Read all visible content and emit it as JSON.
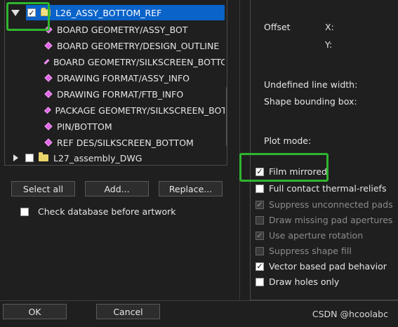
{
  "tree": {
    "items": [
      {
        "label": "L26_ASSY_BOTTOM_REF",
        "checked": "✓"
      },
      {
        "label": "BOARD GEOMETRY/ASSY_BOT"
      },
      {
        "label": "BOARD GEOMETRY/DESIGN_OUTLINE"
      },
      {
        "label": "BOARD GEOMETRY/SILKSCREEN_BOTTC"
      },
      {
        "label": "DRAWING FORMAT/ASSY_INFO"
      },
      {
        "label": "DRAWING FORMAT/FTB_INFO"
      },
      {
        "label": "PACKAGE GEOMETRY/SILKSCREEN_BOT"
      },
      {
        "label": "PIN/BOTTOM"
      },
      {
        "label": "REF DES/SILKSCREEN_BOTTOM"
      },
      {
        "label": "L27_assembly_DWG"
      }
    ]
  },
  "buttons": {
    "select_all": "Select all",
    "add": "Add...",
    "replace": "Replace...",
    "ok": "OK",
    "cancel": "Cancel"
  },
  "check_database": {
    "label": "Check database before artwork",
    "checked": ""
  },
  "right": {
    "offset_label": "Offset",
    "x_label": "X:",
    "y_label": "Y:",
    "undefined_line_width": "Undefined line width:",
    "shape_bounding_box": "Shape bounding box:",
    "plot_mode": "Plot mode:",
    "options": [
      {
        "label": "Film mirrored",
        "checked": "✓"
      },
      {
        "label": "Full contact thermal-reliefs",
        "checked": ""
      },
      {
        "label": "Suppress unconnected pads",
        "checked": "✓"
      },
      {
        "label": "Draw missing pad apertures",
        "checked": ""
      },
      {
        "label": "Use aperture rotation",
        "checked": "✓"
      },
      {
        "label": "Suppress shape fill",
        "checked": ""
      },
      {
        "label": "Vector based pad behavior",
        "checked": "✓"
      },
      {
        "label": "Draw holes only",
        "checked": ""
      }
    ]
  },
  "watermark": "CSDN @hcoolabc",
  "colors": {
    "selection": "#0a63c9",
    "highlight_box": "#2fb52f",
    "layer_diamond": "#e066e6",
    "folder": "#e9d46a"
  }
}
